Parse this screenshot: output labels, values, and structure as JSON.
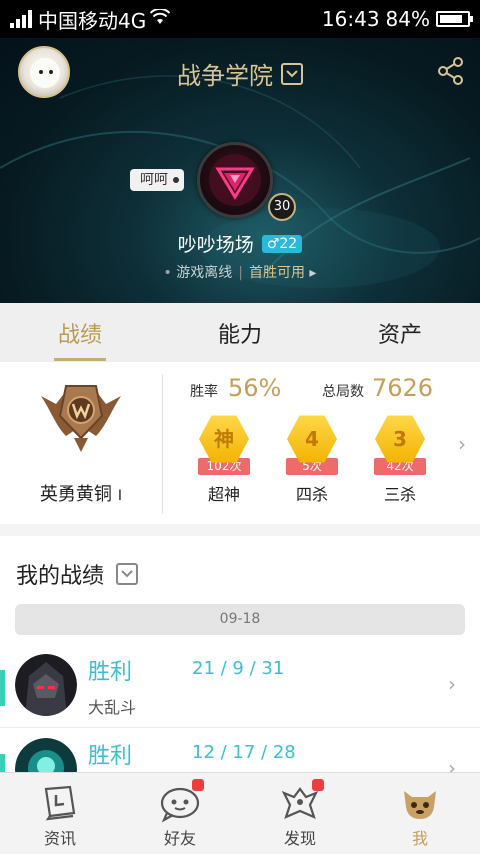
{
  "status_bar": {
    "carrier": "中国移动4G",
    "time": "16:43",
    "battery": "84%",
    "battery_level": 0.84
  },
  "header": {
    "server": "战争学院",
    "nick_tag": "呵呵",
    "level": "30",
    "player_name": "吵吵场场",
    "gender_age": "♂22",
    "game_status": "游戏离线",
    "first_win": "首胜可用"
  },
  "tabs": [
    {
      "label": "战绩",
      "active": true
    },
    {
      "label": "能力",
      "active": false
    },
    {
      "label": "资产",
      "active": false
    }
  ],
  "stats": {
    "rank_name": "英勇黄铜",
    "rank_tier": "I",
    "winrate_label": "胜率",
    "winrate_value": "56%",
    "total_label": "总局数",
    "total_value": "7626",
    "medals": [
      {
        "glyph": "神",
        "count": "102次",
        "label": "超神"
      },
      {
        "glyph": "4",
        "count": "5次",
        "label": "四杀"
      },
      {
        "glyph": "3",
        "count": "42次",
        "label": "三杀"
      }
    ]
  },
  "records": {
    "title": "我的战绩",
    "date": "09-18",
    "matches": [
      {
        "result": "胜利",
        "kda": "21 / 9 / 31",
        "mode": "大乱斗"
      },
      {
        "result": "胜利",
        "kda": "12 / 17 / 28",
        "mode": ""
      }
    ]
  },
  "bottom_nav": [
    {
      "label": "资讯",
      "icon": "news-book-icon",
      "badge": false,
      "active": false
    },
    {
      "label": "好友",
      "icon": "friends-chat-icon",
      "badge": true,
      "active": false
    },
    {
      "label": "发现",
      "icon": "discover-icon",
      "badge": true,
      "active": false
    },
    {
      "label": "我",
      "icon": "me-icon",
      "badge": false,
      "active": true
    }
  ],
  "colors": {
    "accent_gold": "#c59e59",
    "win_cyan": "#3bbfd3",
    "badge_red": "#ef3c3c"
  }
}
